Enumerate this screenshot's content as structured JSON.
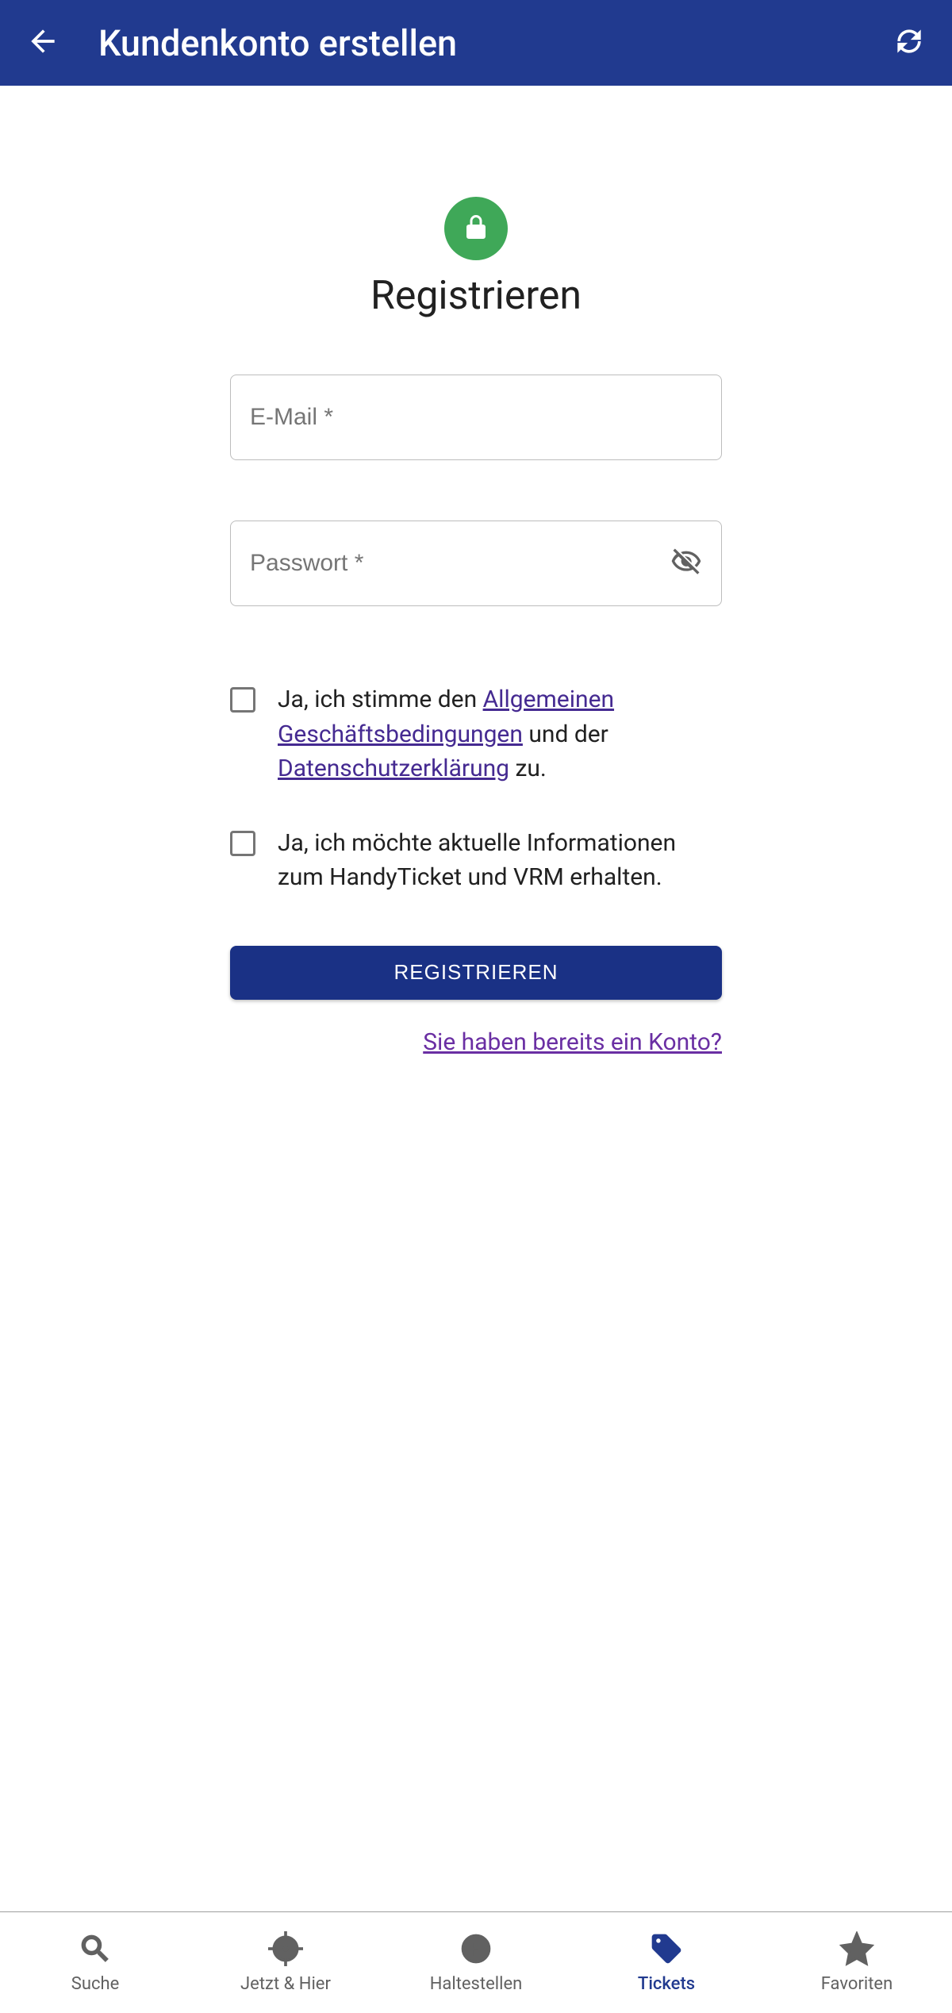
{
  "appbar": {
    "title": "Kundenkonto erstellen"
  },
  "register": {
    "heading": "Registrieren",
    "email_placeholder": "E-Mail *",
    "password_placeholder": "Passwort *",
    "consent_terms_prefix": "Ja, ich stimme den ",
    "consent_terms_link1": "Allgemeinen Geschäftsbedingungen",
    "consent_terms_mid": " und der ",
    "consent_terms_link2": "Datenschutzerklärung",
    "consent_terms_suffix": " zu.",
    "consent_newsletter": "Ja, ich möchte aktuelle Informationen zum HandyTicket und VRM erhalten.",
    "submit_label": "REGISTRIEREN",
    "have_account": "Sie haben bereits ein Konto?"
  },
  "nav": {
    "search": "Suche",
    "here_now": "Jetzt & Hier",
    "stops": "Haltestellen",
    "tickets": "Tickets",
    "favorites": "Favoriten"
  }
}
